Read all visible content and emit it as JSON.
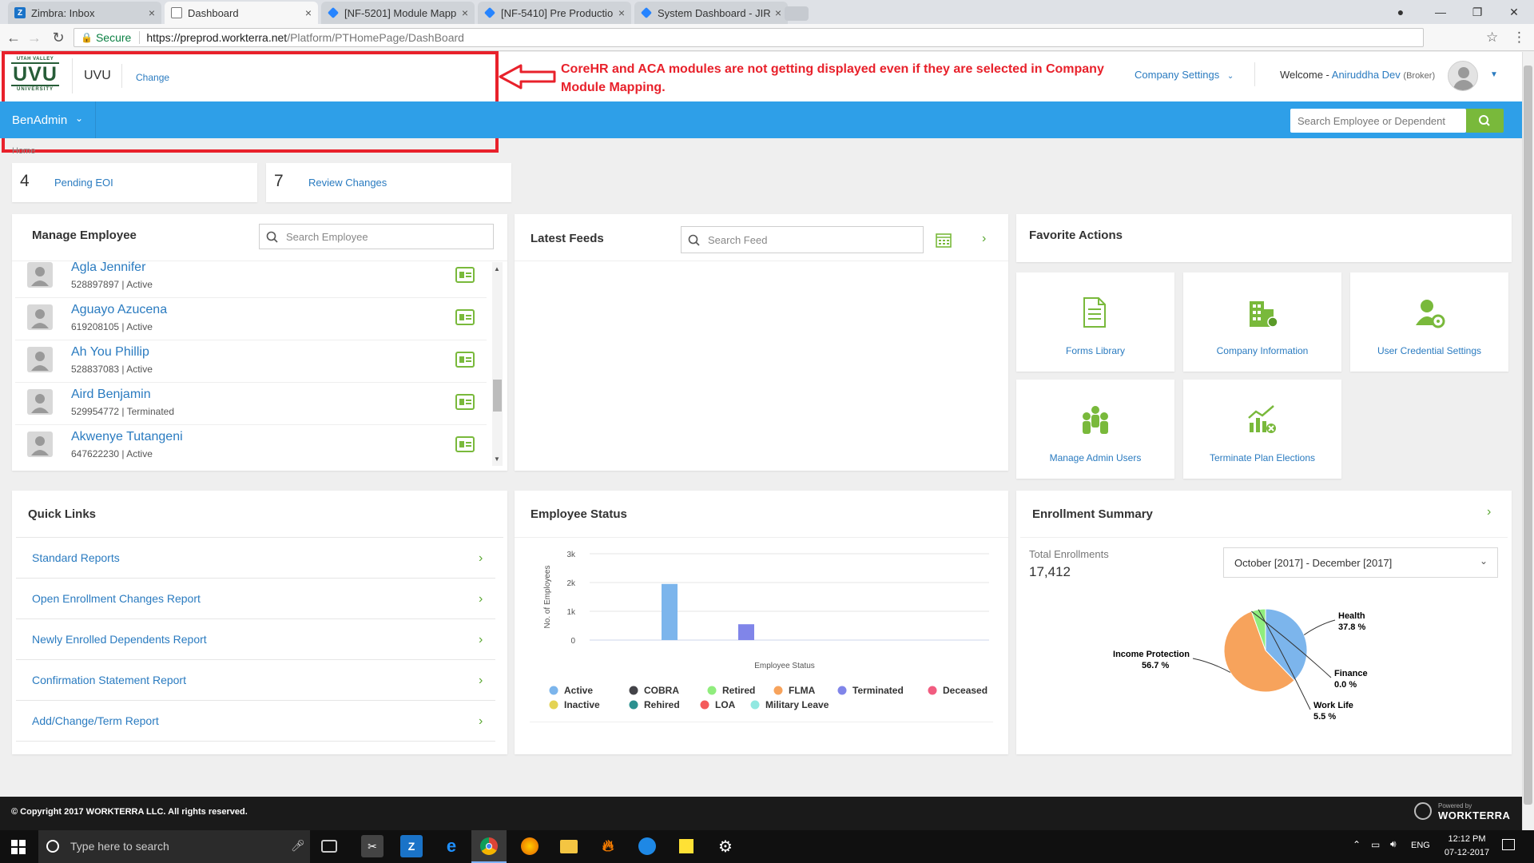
{
  "browser": {
    "tabs": [
      {
        "label": "Zimbra: Inbox",
        "favicon": "zimbra-icon",
        "active": false
      },
      {
        "label": "Dashboard",
        "favicon": "page-icon",
        "active": true
      },
      {
        "label": "[NF-5201] Module Mapp",
        "favicon": "jira-icon",
        "active": false
      },
      {
        "label": "[NF-5410] Pre Productio",
        "favicon": "jira-icon",
        "active": false
      },
      {
        "label": "System Dashboard - JIRA",
        "favicon": "jira-icon",
        "active": false
      }
    ],
    "secure_label": "Secure",
    "url_host": "https://preprod.workterra.net",
    "url_path": "/Platform/PTHomePage/DashBoard"
  },
  "header": {
    "logo_top": "UTAH VALLEY",
    "logo_main": "UVU",
    "logo_bottom": "UNIVERSITY",
    "company": "UVU",
    "change_label": "Change",
    "company_settings": "Company Settings",
    "welcome_prefix": "Welcome - ",
    "user_name": "Aniruddha Dev",
    "user_role": "(Broker)"
  },
  "annotation": {
    "text": "CoreHR and ACA modules are not getting displayed even if they are selected in Company Module Mapping."
  },
  "navbar": {
    "menu_label": "BenAdmin",
    "search_placeholder": "Search Employee or Dependent"
  },
  "breadcrumb": "Home",
  "stats": [
    {
      "value": "4",
      "label": "Pending EOI"
    },
    {
      "value": "7",
      "label": "Review Changes"
    }
  ],
  "manage_employee": {
    "title": "Manage Employee",
    "search_placeholder": "Search Employee",
    "employees": [
      {
        "name": "Agla Jennifer",
        "meta": "528897897 | Active"
      },
      {
        "name": "Aguayo Azucena",
        "meta": "619208105 | Active"
      },
      {
        "name": "Ah You Phillip",
        "meta": "528837083 | Active"
      },
      {
        "name": "Aird Benjamin",
        "meta": "529954772 | Terminated"
      },
      {
        "name": "Akwenye Tutangeni",
        "meta": "647622230 | Active"
      }
    ]
  },
  "latest_feeds": {
    "title": "Latest Feeds",
    "search_placeholder": "Search Feed"
  },
  "favorite_actions": {
    "title": "Favorite Actions",
    "items": [
      {
        "label": "Forms Library",
        "icon": "forms-library-icon"
      },
      {
        "label": "Company Information",
        "icon": "company-building-icon"
      },
      {
        "label": "User Credential Settings",
        "icon": "user-settings-icon"
      },
      {
        "label": "Manage Admin Users",
        "icon": "admin-users-icon"
      },
      {
        "label": "Terminate Plan Elections",
        "icon": "terminate-plan-icon"
      }
    ]
  },
  "quick_links": {
    "title": "Quick Links",
    "items": [
      "Standard Reports",
      "Open Enrollment Changes Report",
      "Newly Enrolled Dependents Report",
      "Confirmation Statement Report",
      "Add/Change/Term Report"
    ]
  },
  "employee_status": {
    "title": "Employee Status",
    "legend": [
      {
        "name": "Active",
        "color": "#7cb5ec"
      },
      {
        "name": "COBRA",
        "color": "#434348"
      },
      {
        "name": "Retired",
        "color": "#90ed7d"
      },
      {
        "name": "FLMA",
        "color": "#f7a35c"
      },
      {
        "name": "Terminated",
        "color": "#8085e9"
      },
      {
        "name": "Deceased",
        "color": "#f15c80"
      },
      {
        "name": "Inactive",
        "color": "#e4d354"
      },
      {
        "name": "Rehired",
        "color": "#2b908f"
      },
      {
        "name": "LOA",
        "color": "#f45b5b"
      },
      {
        "name": "Military Leave",
        "color": "#91e8e1"
      }
    ]
  },
  "enrollment_summary": {
    "title": "Enrollment Summary",
    "total_label": "Total Enrollments",
    "total_value": "17,412",
    "period": "October [2017] - December [2017]",
    "labels": [
      {
        "name": "Health",
        "pct": "37.8 %"
      },
      {
        "name": "Income Protection",
        "pct": "56.7 %"
      },
      {
        "name": "Finance",
        "pct": "0.0 %"
      },
      {
        "name": "Work Life",
        "pct": "5.5 %"
      }
    ]
  },
  "chart_data": [
    {
      "type": "bar",
      "title": "Employee Status",
      "xlabel": "Employee Status",
      "ylabel": "No. of Employees",
      "ylim": [
        0,
        3000
      ],
      "yticks": [
        "0",
        "1k",
        "2k",
        "3k"
      ],
      "grid": true,
      "legend": "bottom",
      "series": [
        {
          "name": "Active",
          "values": [
            1950
          ],
          "color": "#7cb5ec"
        },
        {
          "name": "COBRA",
          "values": [
            0
          ],
          "color": "#434348"
        },
        {
          "name": "Retired",
          "values": [
            0
          ],
          "color": "#90ed7d"
        },
        {
          "name": "FLMA",
          "values": [
            0
          ],
          "color": "#f7a35c"
        },
        {
          "name": "Terminated",
          "values": [
            550
          ],
          "color": "#8085e9"
        },
        {
          "name": "Deceased",
          "values": [
            0
          ],
          "color": "#f15c80"
        },
        {
          "name": "Inactive",
          "values": [
            0
          ],
          "color": "#e4d354"
        },
        {
          "name": "Rehired",
          "values": [
            0
          ],
          "color": "#2b908f"
        },
        {
          "name": "LOA",
          "values": [
            0
          ],
          "color": "#f45b5b"
        },
        {
          "name": "Military Leave",
          "values": [
            0
          ],
          "color": "#91e8e1"
        }
      ]
    },
    {
      "type": "pie",
      "title": "Enrollment Summary",
      "categories": [
        "Health",
        "Income Protection",
        "Finance",
        "Work Life"
      ],
      "values": [
        37.8,
        56.7,
        0.0,
        5.5
      ],
      "colors": [
        "#7cb5ec",
        "#f7a35c",
        "#434348",
        "#90ed7d"
      ]
    }
  ],
  "footer": {
    "copyright": "© Copyright 2017 WORKTERRA LLC. All rights reserved.",
    "powered_by": "Powered by",
    "brand": "WORKTERRA"
  },
  "taskbar": {
    "search_placeholder": "Type here to search",
    "language": "ENG",
    "time": "12:12 PM",
    "date": "07-12-2017"
  }
}
